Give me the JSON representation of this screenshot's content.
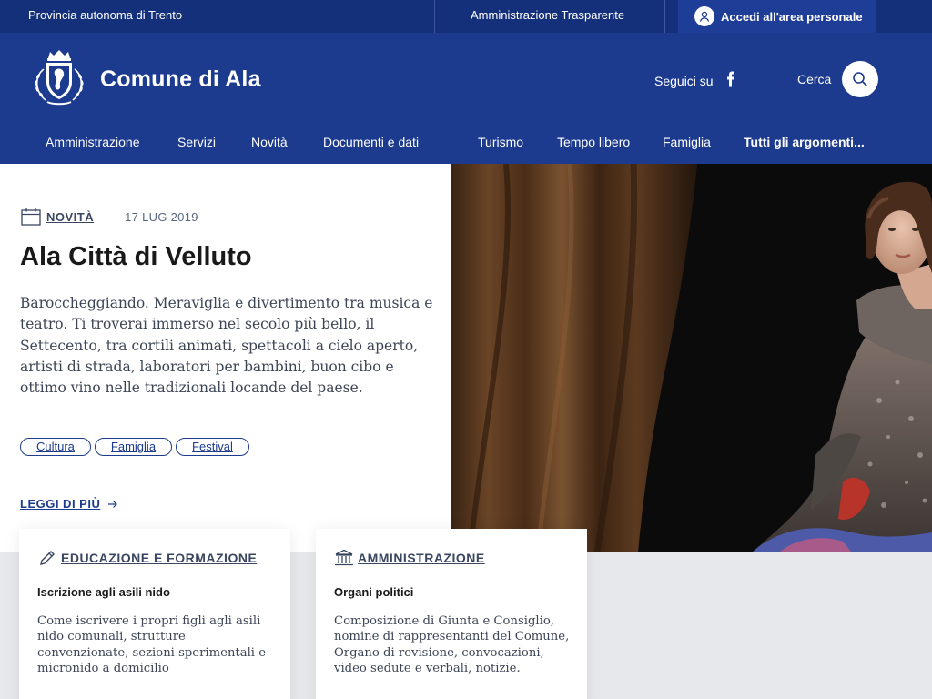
{
  "topbar": {
    "region": "Provincia autonoma di Trento",
    "transparency": "Amministrazione Trasparente",
    "login": "Accedi all'area personale"
  },
  "header": {
    "site_name": "Comune di Ala",
    "follow_label": "Seguici su",
    "search_label": "Cerca"
  },
  "nav": {
    "items": [
      "Amministrazione",
      "Servizi",
      "Novità",
      "Documenti e dati",
      "Turismo",
      "Tempo libero",
      "Famiglia",
      "Tutti gli argomenti..."
    ]
  },
  "hero": {
    "category": "NOVITÀ",
    "dash": "—",
    "date": "17 LUG 2019",
    "title": "Ala Città di Velluto",
    "description": "Baroccheggiando. Meraviglia e divertimento tra musica e teatro. Ti troverai immerso nel secolo più bello, il Settecento, tra cortili animati, spettacoli a cielo aperto, artisti di strada, laboratori per bambini, buon cibo e ottimo vino nelle tradizionali locande del paese.",
    "tags": [
      "Cultura",
      "Famiglia",
      "Festival"
    ],
    "read_more": "LEGGI DI PIÙ"
  },
  "cards": [
    {
      "category": "EDUCAZIONE E FORMAZIONE",
      "icon": "pencil-icon",
      "title": "Iscrizione agli asili nido",
      "text": "Come iscrivere i propri figli agli asili nido comunali, strutture convenzionate, sezioni sperimentali e micronido a domicilio"
    },
    {
      "category": "AMMINISTRAZIONE",
      "icon": "government-building-icon",
      "title": "Organi politici",
      "text": "Composizione di Giunta e Consiglio, nomine di rappresentanti del Comune, Organo di revisione, convocazioni, video sedute e verbali, notizie."
    }
  ],
  "colors": {
    "topbar": "#15307a",
    "header": "#1c3b8f",
    "band": "#e6e8ec"
  }
}
